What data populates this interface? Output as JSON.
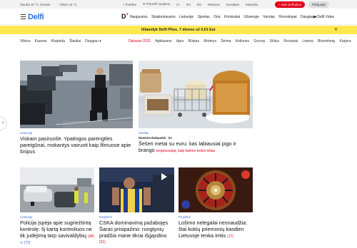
{
  "topbar": {
    "weather": "Šiauliai 16 °C, šviesiai",
    "weather2": "Vilnius 16 °C",
    "menu": [
      "Paieška",
      "Pranešk naujieną",
      "LT",
      "RU",
      "EN",
      "Reklama",
      "Kontaktai",
      "Statistika"
    ],
    "plus_button": "+ Apie Delfi plius",
    "login_button": "Prisijungti"
  },
  "header": {
    "logo": "Delfi",
    "plus_logo": "D",
    "plus_sup": "+",
    "nav": [
      "Naujausios",
      "Skaitomiausios",
      "Lietuvoje",
      "Sportas",
      "Orai",
      "Kriminalai",
      "Užsienyje",
      "Verslas",
      "Horoskopai",
      "Daugiau ▾"
    ],
    "video": "Delfi Video"
  },
  "promo": {
    "text": "Išbandyk Delfi Plius. 7 dienos už 0,01 Eur",
    "close": "✕"
  },
  "subnav": {
    "left": [
      "Vilnius",
      "Kaunas",
      "Klaipėda",
      "Šiauliai",
      "Daugiau ▾"
    ],
    "right": [
      "Dakaras 2021",
      "Apklausos",
      "Agro",
      "Būstas",
      "Moterys",
      "Šeima",
      "Keliones",
      "Grynas",
      "Stilius",
      "Receptai",
      "Letena",
      "Bloomberg",
      "Karjera"
    ]
  },
  "cards": [
    {
      "category": "Lietuvoje",
      "title": "Viskam pasiruošė. Ypatingos parengtles pareigūnai, mokantys vairuoti kaip filmuose apie šnipus"
    },
    {
      "category": "Verslas",
      "author": "Raminta Rakauskė",
      "author_badge": "D+",
      "title": "Šešeri metai su euru: kas labiausiai pigo ir brango",
      "tags": "prognozuoja, kaip kainos keisis toliau"
    },
    {
      "category": "Lietuvoje",
      "title": "Policija įspėja apie sugriežtintą kontrolę: šį kartą kontroliuos ne tik judėjimą tarp savivaldybių",
      "count": "(48)",
      "count2": "⊙ (73)"
    },
    {
      "category": "Krepšinis",
      "title": "CSKA dominavimą pažabojęs Šaras prisipažino: rungtynių pradžia mane tikrai išgąsdino",
      "count": "(21)"
    },
    {
      "category": "Projektai",
      "title": "Lošimo nelegalai nesnaudžia: štai kokių priemonių kasdien Lietuvoje tenka imtis",
      "count": "(17)"
    }
  ],
  "colors": {
    "accent": "#2d6fe0",
    "red": "#e2001a",
    "promo": "#ffe84d"
  }
}
